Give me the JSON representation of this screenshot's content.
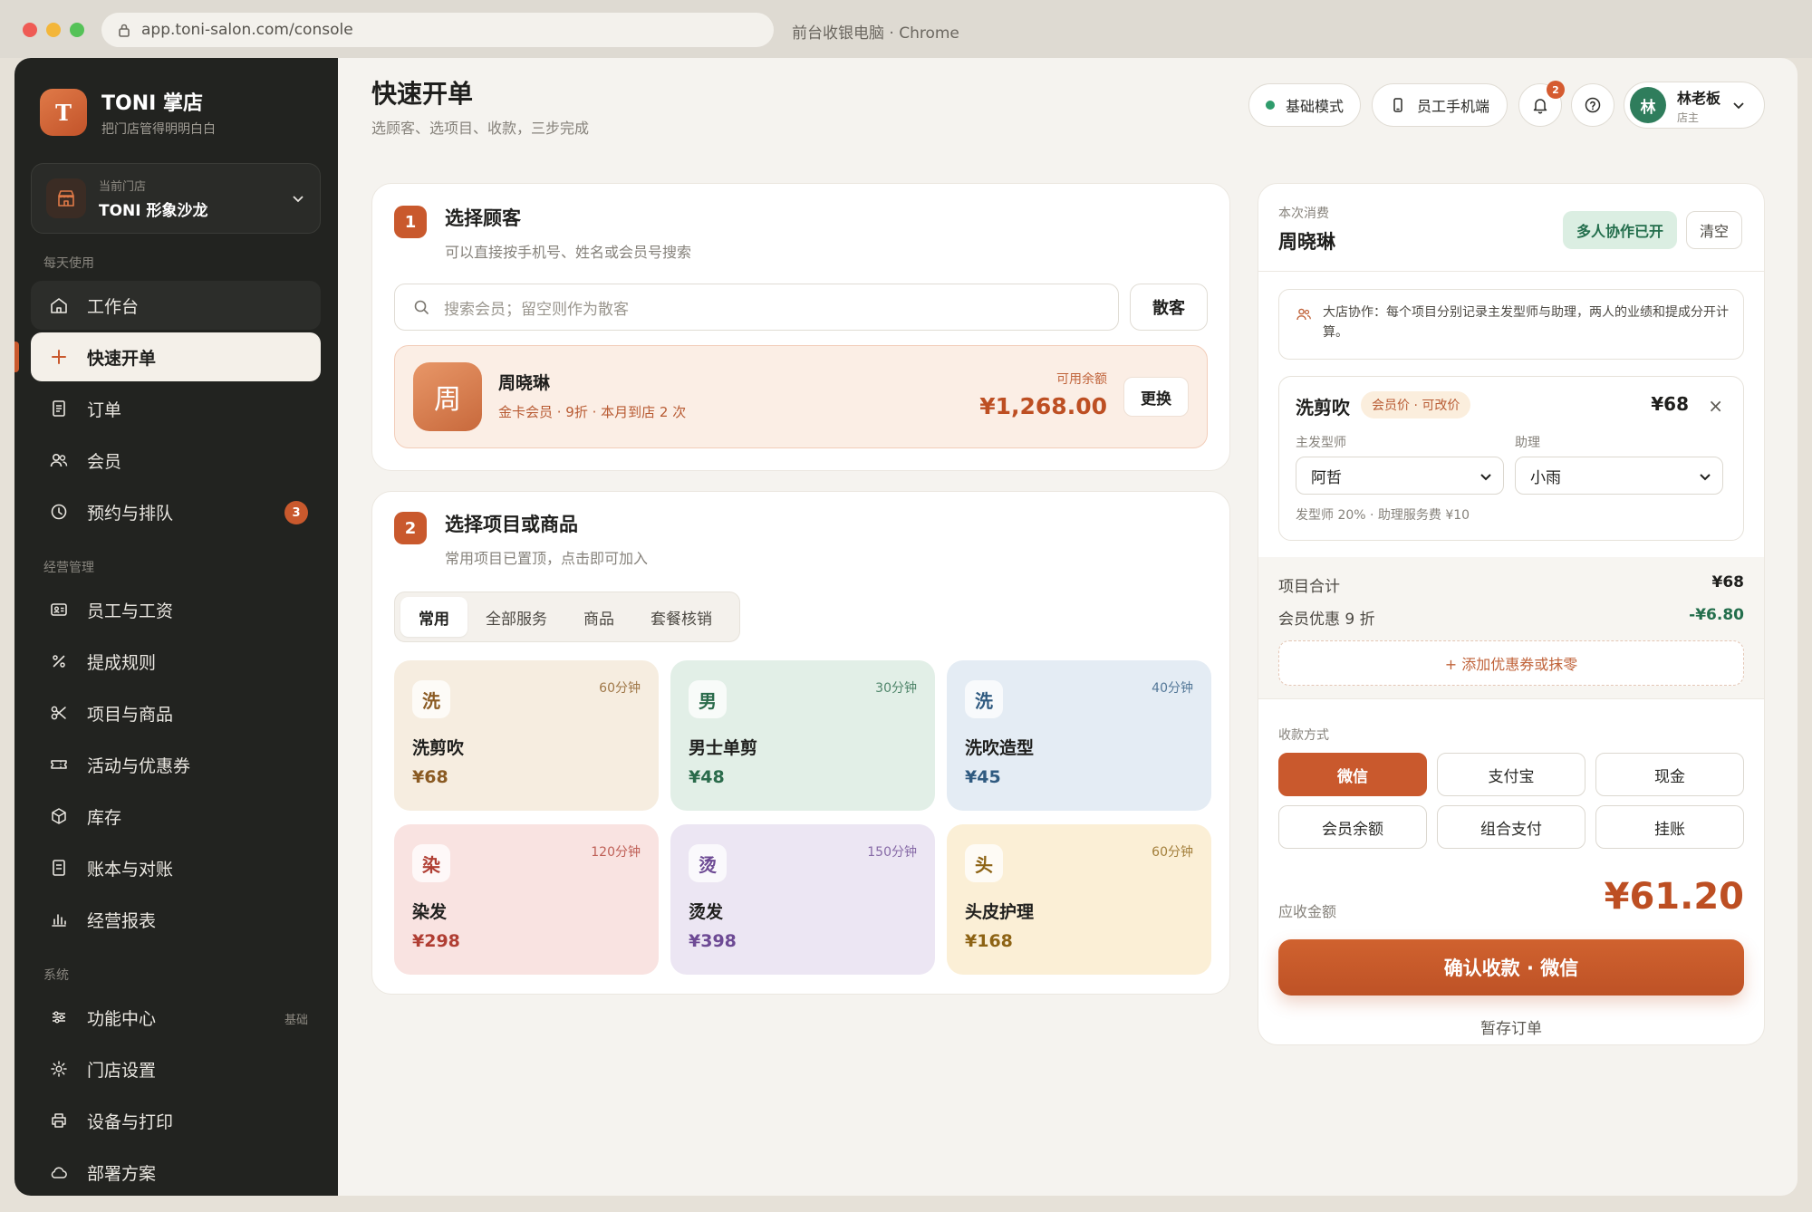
{
  "browser": {
    "url": "app.toni-salon.com/console",
    "title": "前台收银电脑 · Chrome"
  },
  "brand": {
    "logo_letter": "T",
    "name": "TONI 掌店",
    "tagline": "把门店管得明明白白"
  },
  "store": {
    "label": "当前门店",
    "name": "TONI 形象沙龙"
  },
  "sidebar": {
    "sections": [
      "每天使用",
      "经营管理",
      "系统"
    ],
    "items": [
      {
        "label": "工作台",
        "icon": "home-icon"
      },
      {
        "label": "快速开单",
        "icon": "plus-icon",
        "active": true
      },
      {
        "label": "订单",
        "icon": "receipt-icon"
      },
      {
        "label": "会员",
        "icon": "users-icon"
      },
      {
        "label": "预约与排队",
        "icon": "clock-icon",
        "badge": "3"
      },
      {
        "label": "员工与工资",
        "icon": "id-card-icon"
      },
      {
        "label": "提成规则",
        "icon": "percent-icon"
      },
      {
        "label": "项目与商品",
        "icon": "scissors-icon"
      },
      {
        "label": "活动与优惠券",
        "icon": "ticket-icon"
      },
      {
        "label": "库存",
        "icon": "box-icon"
      },
      {
        "label": "账本与对账",
        "icon": "ledger-icon"
      },
      {
        "label": "经营报表",
        "icon": "bar-chart-icon"
      },
      {
        "label": "功能中心",
        "icon": "sliders-icon",
        "tag": "基础"
      },
      {
        "label": "门店设置",
        "icon": "gear-icon"
      },
      {
        "label": "设备与打印",
        "icon": "printer-icon"
      },
      {
        "label": "部署方案",
        "icon": "cloud-icon"
      }
    ]
  },
  "header": {
    "title": "快速开单",
    "subtitle": "选顾客、选项目、收款，三步完成",
    "mode_label": "基础模式",
    "phone_label": "员工手机端",
    "notifications": "2",
    "user": {
      "avatar": "林",
      "name": "林老板",
      "role": "店主"
    }
  },
  "step1": {
    "num": "1",
    "title": "选择顾客",
    "subtitle": "可以直接按手机号、姓名或会员号搜索",
    "search_placeholder": "搜索会员；留空则作为散客",
    "walkin_label": "散客",
    "member": {
      "avatar": "周",
      "name": "周晓琳",
      "info": "金卡会员 · 9折 · 本月到店 2 次",
      "balance_label": "可用余额",
      "balance": "¥1,268.00",
      "change_label": "更换"
    }
  },
  "step2": {
    "num": "2",
    "title": "选择项目或商品",
    "subtitle": "常用项目已置顶，点击即可加入",
    "tabs": [
      "常用",
      "全部服务",
      "商品",
      "套餐核销"
    ],
    "services": [
      {
        "char": "洗",
        "name": "洗剪吹",
        "price": "¥68",
        "duration": "60分钟",
        "bg": "#f6ede0",
        "accent": "#8a5a22"
      },
      {
        "char": "男",
        "name": "男士单剪",
        "price": "¥48",
        "duration": "30分钟",
        "bg": "#e2efe7",
        "accent": "#2a6b4b"
      },
      {
        "char": "洗",
        "name": "洗吹造型",
        "price": "¥45",
        "duration": "40分钟",
        "bg": "#e4ecf4",
        "accent": "#2f5a80"
      },
      {
        "char": "染",
        "name": "染发",
        "price": "¥298",
        "duration": "120分钟",
        "bg": "#f9e3e1",
        "accent": "#b03e33"
      },
      {
        "char": "烫",
        "name": "烫发",
        "price": "¥398",
        "duration": "150分钟",
        "bg": "#ece6f3",
        "accent": "#6d4a94"
      },
      {
        "char": "头",
        "name": "头皮护理",
        "price": "¥168",
        "duration": "60分钟",
        "bg": "#fbefd6",
        "accent": "#8d6314"
      }
    ]
  },
  "order": {
    "label": "本次消费",
    "customer": "周晓琳",
    "collab_tag": "多人协作已开",
    "clear_label": "清空",
    "notice": "大店协作：每个项目分别记录主发型师与助理，两人的业绩和提成分开计算。",
    "item": {
      "name": "洗剪吹",
      "tag": "会员价 · 可改价",
      "price": "¥68",
      "close": "×",
      "stylist_label": "主发型师",
      "stylist": "阿哲",
      "assistant_label": "助理",
      "assistant": "小雨",
      "footnote": "发型师 20% · 助理服务费 ¥10"
    },
    "subtotal_label": "项目合计",
    "subtotal": "¥68",
    "discount_label": "会员优惠 9 折",
    "discount": "-¥6.80",
    "coupon_label": "+ 添加优惠券或抹零",
    "payment_label": "收款方式",
    "payments": [
      "微信",
      "支付宝",
      "现金",
      "会员余额",
      "组合支付",
      "挂账"
    ],
    "due_label": "应收金额",
    "due": "¥61.20",
    "confirm_label": "确认收款 · 微信",
    "save_label": "暂存订单"
  }
}
